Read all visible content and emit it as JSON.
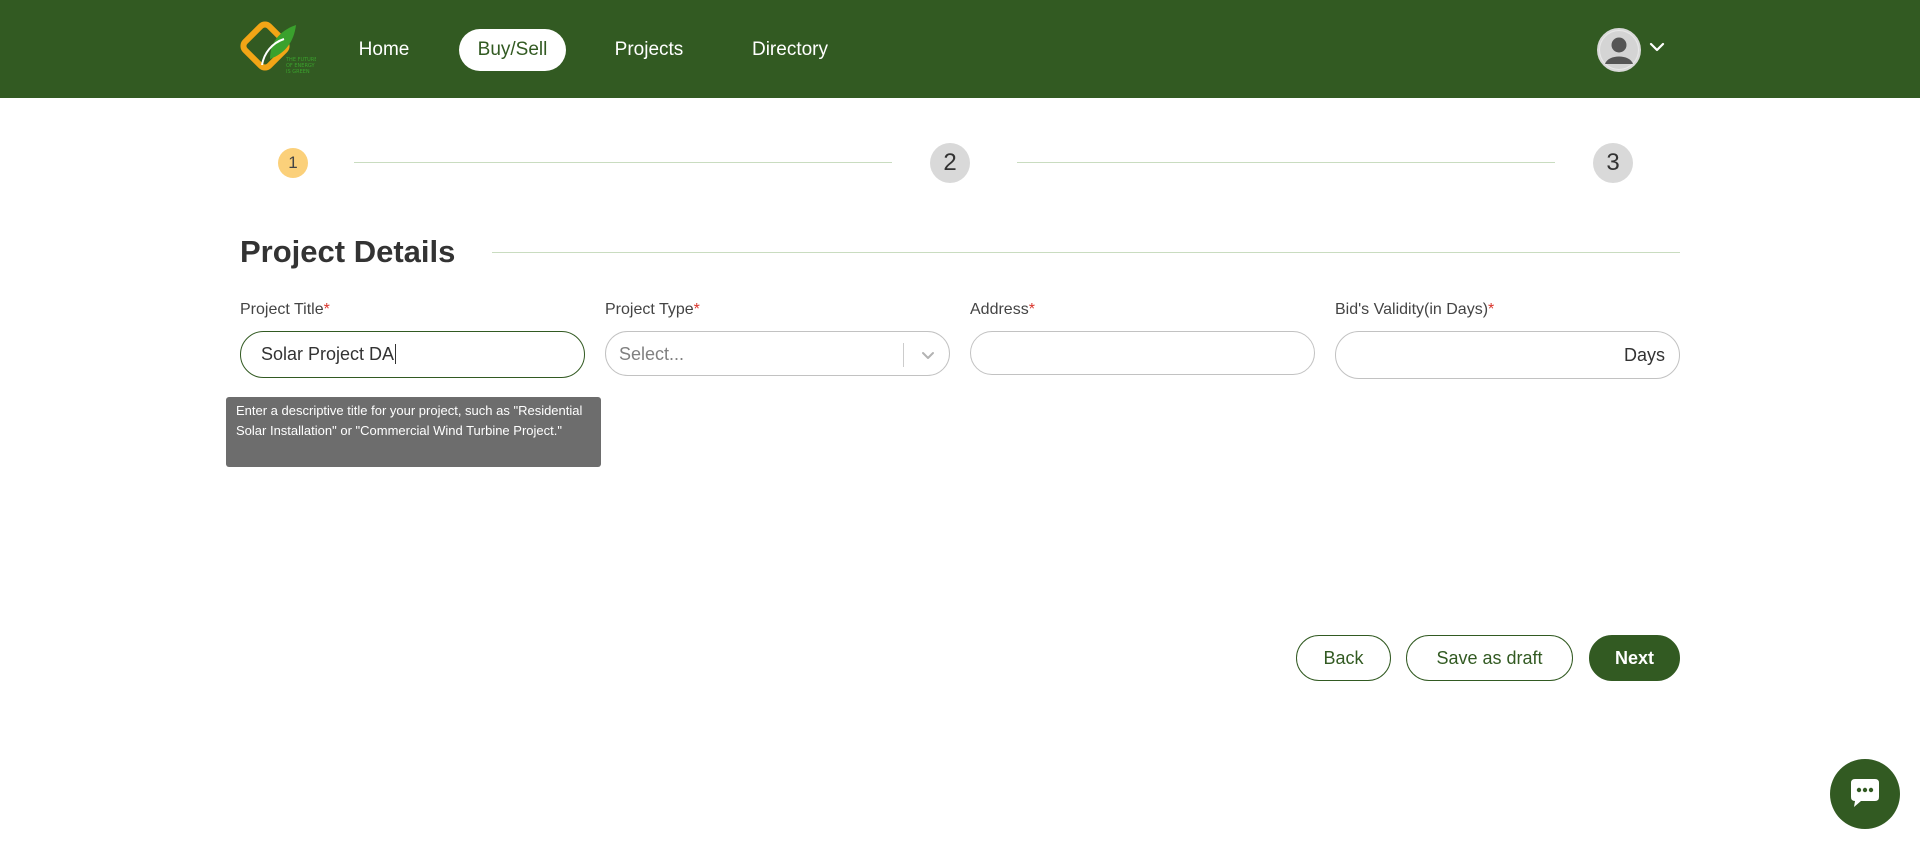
{
  "header": {
    "logo_icon": "company-logo",
    "nav": [
      {
        "label": "Home",
        "active": false
      },
      {
        "label": "Buy/Sell",
        "active": true
      },
      {
        "label": "Projects",
        "active": false
      },
      {
        "label": "Directory",
        "active": false
      }
    ],
    "avatar_icon": "user-avatar-icon",
    "caret_icon": "chevron-down-icon",
    "brand_color": "#325a22"
  },
  "stepper": {
    "steps": [
      "1",
      "2",
      "3"
    ],
    "current": 1,
    "active_color": "#fbd07a",
    "inactive_color": "#d9d9d9"
  },
  "form": {
    "section_title": "Project Details",
    "required_mark": "*",
    "fields": {
      "project_title": {
        "label": "Project Title",
        "value": "Solar Project DA"
      },
      "project_type": {
        "label": "Project Type",
        "placeholder": "Select..."
      },
      "address": {
        "label": "Address",
        "value": ""
      },
      "bid_validity": {
        "label": "Bid's Validity(in Days)",
        "value": "",
        "suffix": "Days"
      }
    },
    "tooltip": "Enter a descriptive title for your project, such as \"Residential Solar Installation\" or \"Commercial Wind Turbine Project.\""
  },
  "actions": {
    "back": "Back",
    "save_draft": "Save as draft",
    "next": "Next"
  },
  "chat": {
    "icon": "chat-bubble-icon"
  }
}
